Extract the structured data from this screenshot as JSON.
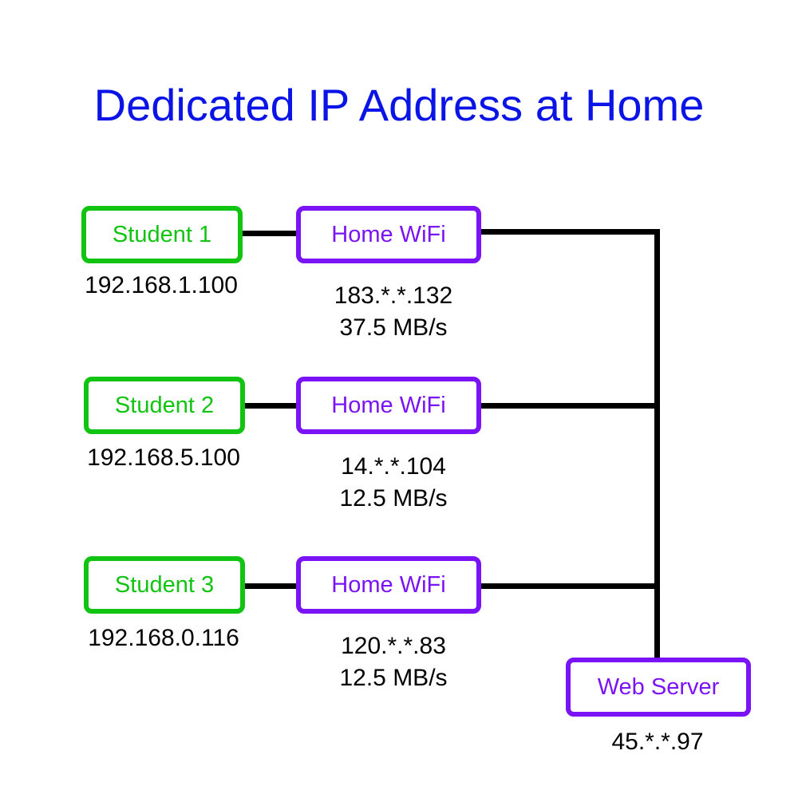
{
  "title": "Dedicated IP Address at Home",
  "students": [
    {
      "name": "Student 1",
      "ip": "192.168.1.100"
    },
    {
      "name": "Student 2",
      "ip": "192.168.5.100"
    },
    {
      "name": "Student 3",
      "ip": "192.168.0.116"
    }
  ],
  "routers": [
    {
      "name": "Home WiFi",
      "ip": "183.*.*.132",
      "speed": "37.5 MB/s"
    },
    {
      "name": "Home WiFi",
      "ip": "14.*.*.104",
      "speed": "12.5 MB/s"
    },
    {
      "name": "Home WiFi",
      "ip": "120.*.*.83",
      "speed": "12.5 MB/s"
    }
  ],
  "server": {
    "name": "Web Server",
    "ip": "45.*.*.97"
  },
  "colors": {
    "title": "#0a14e6",
    "student": "#11c411",
    "router": "#7a13f5",
    "line": "#000000"
  }
}
